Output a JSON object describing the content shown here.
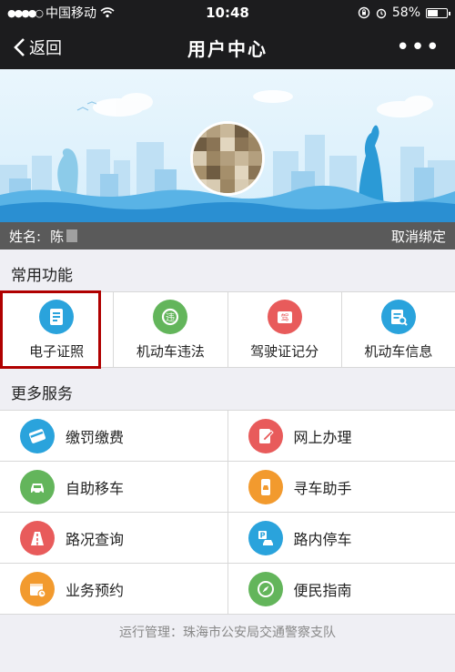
{
  "status_bar": {
    "carrier": "中国移动",
    "time": "10:48",
    "battery": "58%",
    "battery_level": 0.58
  },
  "nav": {
    "back_label": "返回",
    "title": "用户中心",
    "more_icon": "more-dots-icon"
  },
  "user": {
    "name_label": "姓名:",
    "name_value": "陈",
    "unbind_label": "取消绑定"
  },
  "common": {
    "title": "常用功能",
    "items": [
      {
        "label": "电子证照",
        "icon": "id-card-icon",
        "color": "#2aa3dc"
      },
      {
        "label": "机动车违法",
        "icon": "violation-icon",
        "color": "#63b55b"
      },
      {
        "label": "驾驶证记分",
        "icon": "license-score-icon",
        "color": "#e85b5b"
      },
      {
        "label": "机动车信息",
        "icon": "vehicle-info-icon",
        "color": "#2aa3dc"
      }
    ]
  },
  "more": {
    "title": "更多服务",
    "rows": [
      [
        {
          "label": "缴罚缴费",
          "icon": "payment-card-icon",
          "color": "#2aa3dc"
        },
        {
          "label": "网上办理",
          "icon": "online-handle-icon",
          "color": "#e85b5b"
        }
      ],
      [
        {
          "label": "自助移车",
          "icon": "move-car-icon",
          "color": "#63b55b"
        },
        {
          "label": "寻车助手",
          "icon": "find-car-icon",
          "color": "#f29a2e"
        }
      ],
      [
        {
          "label": "路况查询",
          "icon": "road-condition-icon",
          "color": "#e85b5b"
        },
        {
          "label": "路内停车",
          "icon": "parking-icon",
          "color": "#2aa3dc"
        }
      ],
      [
        {
          "label": "业务预约",
          "icon": "appointment-icon",
          "color": "#f29a2e"
        },
        {
          "label": "便民指南",
          "icon": "compass-icon",
          "color": "#63b55b"
        }
      ]
    ]
  },
  "footer": "运行管理：珠海市公安局交通警察支队"
}
